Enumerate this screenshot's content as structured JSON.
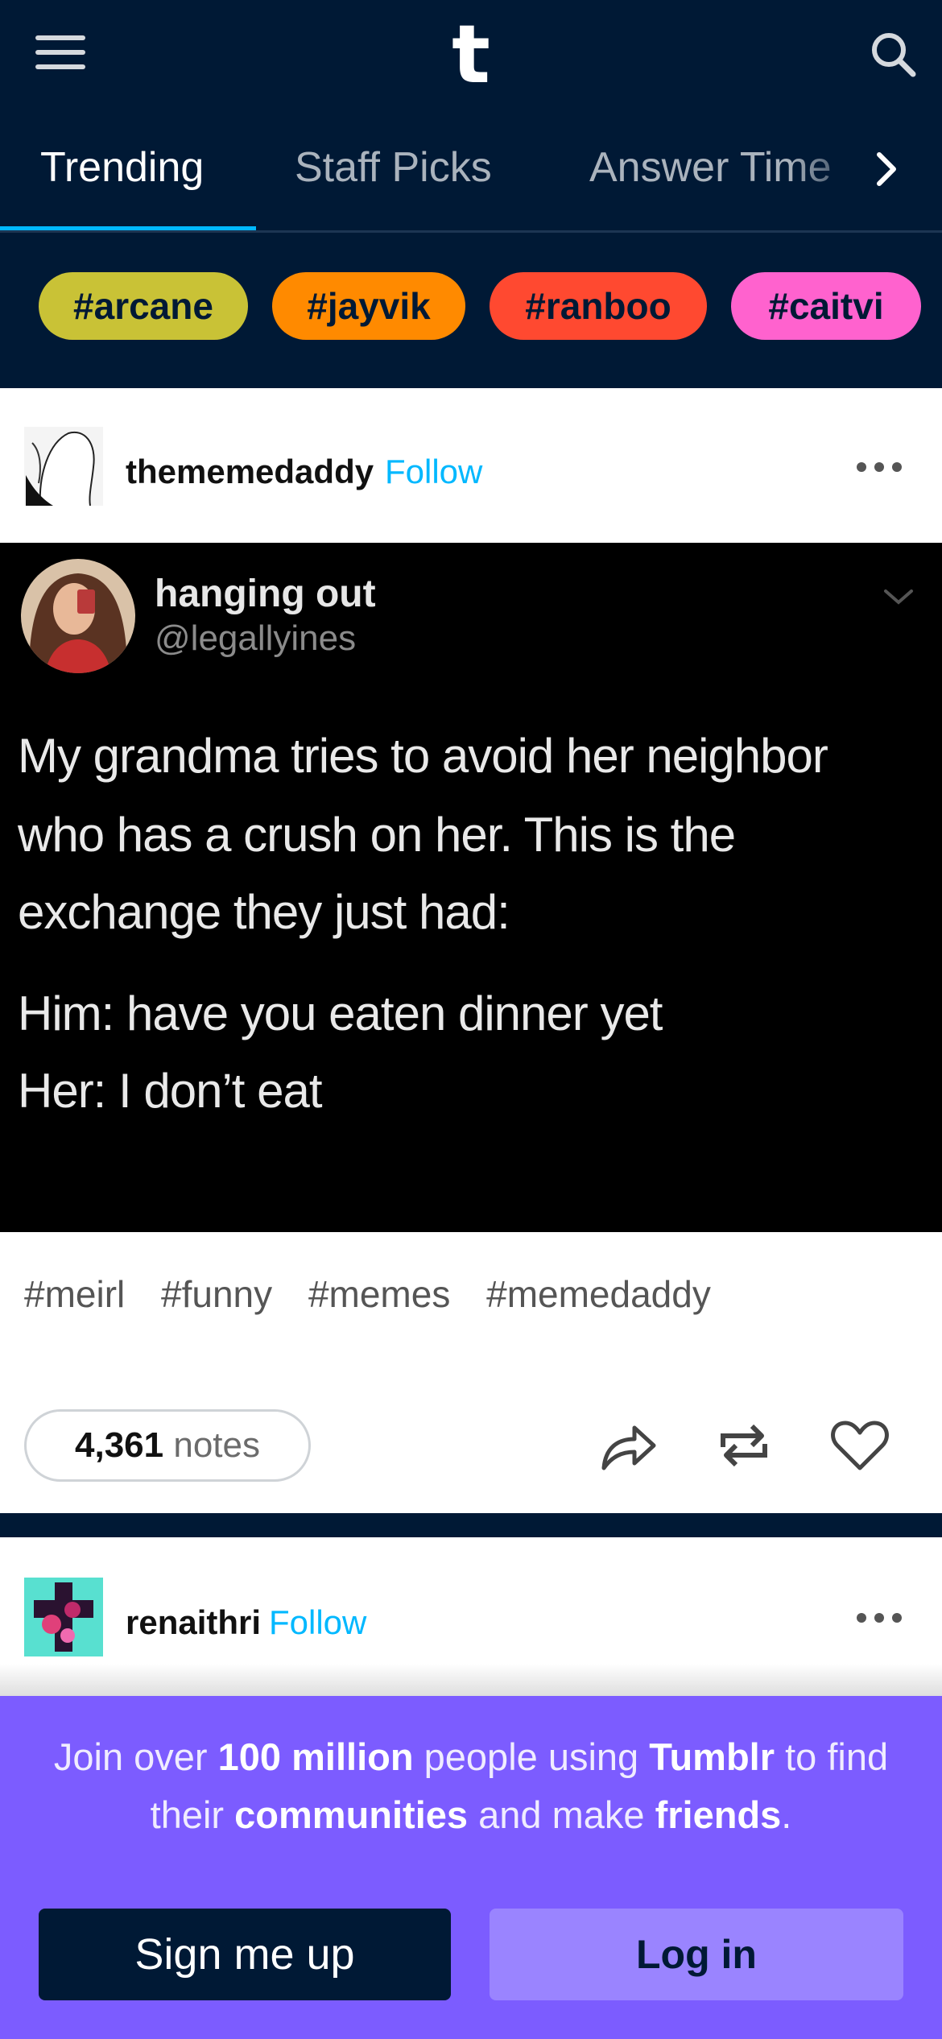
{
  "app": {
    "logo": "t"
  },
  "header": {
    "menu_icon": "hamburger-menu-icon",
    "search_icon": "search-icon"
  },
  "tabs": [
    {
      "label": "Trending",
      "active": true
    },
    {
      "label": "Staff Picks",
      "active": false
    },
    {
      "label": "Answer Time",
      "active": false
    }
  ],
  "tags_row": [
    {
      "label": "#arcane",
      "color": "#c9c236"
    },
    {
      "label": "#jayvik",
      "color": "#ff8a00"
    },
    {
      "label": "#ranboo",
      "color": "#ff4930"
    },
    {
      "label": "#caitvi",
      "color": "#ff62ce"
    }
  ],
  "posts": [
    {
      "username": "thememedaddy",
      "follow_label": "Follow",
      "tweet": {
        "name": "hanging out",
        "handle": "@legallyines",
        "lines": [
          "My grandma tries to avoid her neighbor",
          "who has a crush on her. This is the",
          "exchange they just had:",
          "Him: have you eaten dinner yet",
          "Her: I don’t eat"
        ]
      },
      "tags": [
        "#meirl",
        "#funny",
        "#memes",
        "#memedaddy"
      ],
      "notes_count": "4,361",
      "notes_label": "notes"
    },
    {
      "username": "renaithri",
      "follow_label": "Follow"
    }
  ],
  "banner": {
    "t1": "Join over ",
    "b1": "100 million",
    "t2": " people using ",
    "b2": "Tumblr",
    "t3": " to find",
    "t4": "their ",
    "b3": "communities",
    "t5": " and make ",
    "b4": "friends",
    "t6": ".",
    "signup_label": "Sign me up",
    "login_label": "Log in"
  },
  "colors": {
    "background": "#001935",
    "accent": "#00b8ff",
    "banner": "#7c5cff"
  }
}
